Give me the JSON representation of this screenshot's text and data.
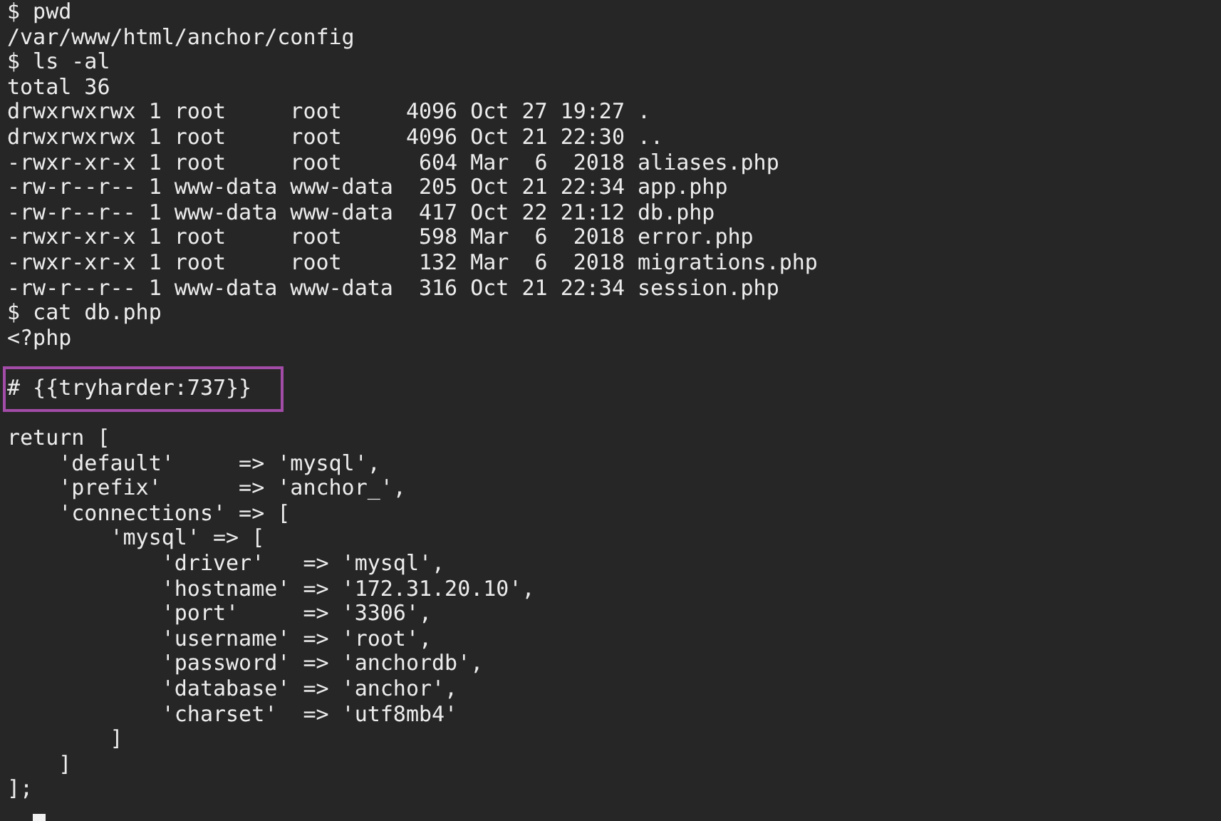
{
  "terminal": {
    "cursor_visible": true,
    "lines": [
      {
        "kind": "text",
        "text": "$ pwd"
      },
      {
        "kind": "text",
        "text": "/var/www/html/anchor/config"
      },
      {
        "kind": "text",
        "text": "$ ls -al"
      },
      {
        "kind": "text",
        "text": "total 36"
      },
      {
        "kind": "text",
        "text": "drwxrwxrwx 1 root     root     4096 Oct 27 19:27 ."
      },
      {
        "kind": "text",
        "text": "drwxrwxrwx 1 root     root     4096 Oct 21 22:30 .."
      },
      {
        "kind": "text",
        "text": "-rwxr-xr-x 1 root     root      604 Mar  6  2018 aliases.php"
      },
      {
        "kind": "text",
        "text": "-rw-r--r-- 1 www-data www-data  205 Oct 21 22:34 app.php"
      },
      {
        "kind": "text",
        "text": "-rw-r--r-- 1 www-data www-data  417 Oct 22 21:12 db.php"
      },
      {
        "kind": "text",
        "text": "-rwxr-xr-x 1 root     root      598 Mar  6  2018 error.php"
      },
      {
        "kind": "text",
        "text": "-rwxr-xr-x 1 root     root      132 Mar  6  2018 migrations.php"
      },
      {
        "kind": "text",
        "text": "-rw-r--r-- 1 www-data www-data  316 Oct 21 22:34 session.php"
      },
      {
        "kind": "text",
        "text": "$ cat db.php"
      },
      {
        "kind": "text",
        "text": "<?php"
      },
      {
        "kind": "blank"
      },
      {
        "kind": "highlighted",
        "text": "# {{tryharder:737}}"
      },
      {
        "kind": "blank"
      },
      {
        "kind": "text",
        "text": "return ["
      },
      {
        "kind": "text",
        "text": "    'default'     => 'mysql',"
      },
      {
        "kind": "text",
        "text": "    'prefix'      => 'anchor_',"
      },
      {
        "kind": "text",
        "text": "    'connections' => ["
      },
      {
        "kind": "text",
        "text": "        'mysql' => ["
      },
      {
        "kind": "text",
        "text": "            'driver'   => 'mysql',"
      },
      {
        "kind": "text",
        "text": "            'hostname' => '172.31.20.10',"
      },
      {
        "kind": "text",
        "text": "            'port'     => '3306',"
      },
      {
        "kind": "text",
        "text": "            'username' => 'root',"
      },
      {
        "kind": "text",
        "text": "            'password' => 'anchordb',"
      },
      {
        "kind": "text",
        "text": "            'database' => 'anchor',"
      },
      {
        "kind": "text",
        "text": "            'charset'  => 'utf8mb4'"
      },
      {
        "kind": "text",
        "text": "        ]"
      },
      {
        "kind": "text",
        "text": "    ]"
      },
      {
        "kind": "text",
        "text": "];"
      }
    ]
  }
}
